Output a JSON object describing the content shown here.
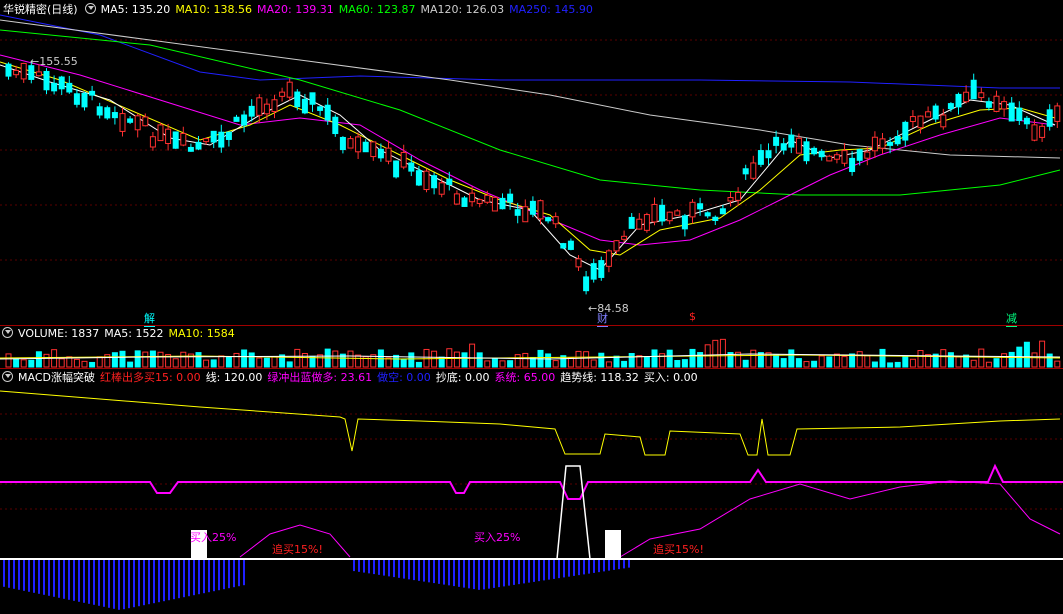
{
  "main_panel": {
    "stock_name": "华锐精密(日线)",
    "ma": [
      {
        "label": "MA5: 135.20",
        "color": "#ffffff"
      },
      {
        "label": "MA10: 138.56",
        "color": "#ffff00"
      },
      {
        "label": "MA20: 139.31",
        "color": "#ff00ff"
      },
      {
        "label": "MA60: 123.87",
        "color": "#00ff00"
      },
      {
        "label": "MA120: 126.03",
        "color": "#cccccc"
      },
      {
        "label": "MA250: 145.90",
        "color": "#2020ff"
      }
    ],
    "high_marker": "155.55",
    "low_marker": "84.58",
    "events": [
      {
        "text": "解",
        "color": "#00ffff"
      },
      {
        "text": "财",
        "color": "#8080ff"
      },
      {
        "text": "$",
        "color": "#ff2020"
      },
      {
        "text": "减",
        "color": "#00ff80"
      }
    ]
  },
  "volume_panel": {
    "items": [
      {
        "label": "VOLUME: 1837",
        "color": "#ffffff"
      },
      {
        "label": "MA5: 1522",
        "color": "#ffffff"
      },
      {
        "label": "MA10: 1584",
        "color": "#ffff00"
      }
    ]
  },
  "indicator_panel": {
    "items": [
      {
        "label": "MACD涨幅突破",
        "color": "#ffffff"
      },
      {
        "label": "红棒出多买15: 0.00",
        "color": "#ff2020"
      },
      {
        "label": "线: 120.00",
        "color": "#ffffff"
      },
      {
        "label": "绿冲出蓝做多: 23.61",
        "color": "#ff00ff"
      },
      {
        "label": "做空: 0.00",
        "color": "#2020ff"
      },
      {
        "label": "抄底: 0.00",
        "color": "#ffffff"
      },
      {
        "label": "系统: 65.00",
        "color": "#ff00ff"
      },
      {
        "label": "趋势线: 118.32",
        "color": "#ffffff"
      },
      {
        "label": "买入: 0.00",
        "color": "#ffffff"
      }
    ],
    "annotations": [
      {
        "text": "买入25%",
        "color": "#ff00ff"
      },
      {
        "text": "追买15%!",
        "color": "#ff2020"
      },
      {
        "text": "买入25%",
        "color": "#ff00ff"
      },
      {
        "text": "追买15%!",
        "color": "#ff2020"
      }
    ]
  }
}
